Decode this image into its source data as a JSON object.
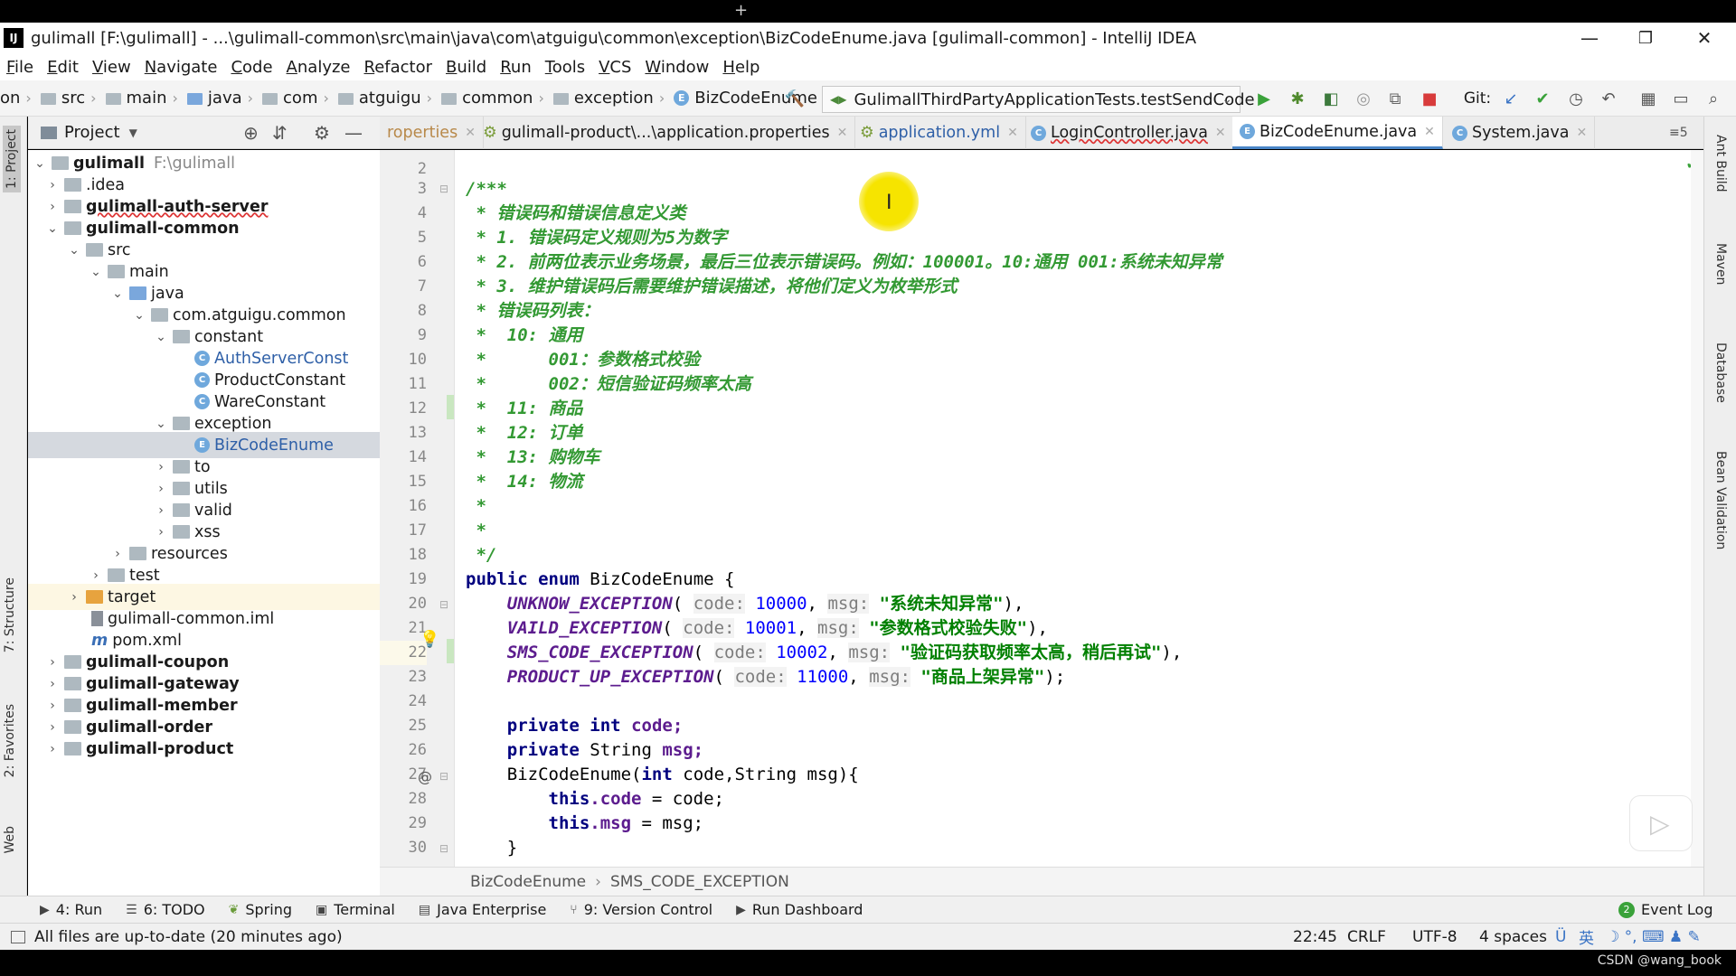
{
  "window": {
    "title": "gulimall [F:\\gulimall] - ...\\gulimall-common\\src\\main\\java\\com\\atguigu\\common\\exception\\BizCodeEnume.java [gulimall-common] - IntelliJ IDEA",
    "logo": "IJ",
    "minimize": "—",
    "restore": "❐",
    "close": "✕"
  },
  "menu": [
    "File",
    "Edit",
    "View",
    "Navigate",
    "Code",
    "Analyze",
    "Refactor",
    "Build",
    "Run",
    "Tools",
    "VCS",
    "Window",
    "Help"
  ],
  "nav": {
    "first": "on",
    "crumbs": [
      "src",
      "main",
      "java",
      "com",
      "atguigu",
      "common",
      "exception"
    ],
    "file": "BizCodeEnume",
    "run_config": "GulimallThirdPartyApplicationTests.testSendCode",
    "git_label": "Git:"
  },
  "left_tabs": {
    "project": "1: Project",
    "structure": "7: Structure",
    "favorites": "2: Favorites",
    "web": "Web"
  },
  "right_tabs": {
    "ant": "Ant Build",
    "maven": "Maven",
    "database": "Database",
    "bean": "Bean Validation"
  },
  "project_panel": {
    "title": "Project",
    "tree": [
      {
        "label": "gulimall",
        "extra": "F:\\gulimall"
      },
      {
        "label": ".idea"
      },
      {
        "label": "gulimall-auth-server"
      },
      {
        "label": "gulimall-common"
      },
      {
        "label": "src"
      },
      {
        "label": "main"
      },
      {
        "label": "java"
      },
      {
        "label": "com.atguigu.common"
      },
      {
        "label": "constant"
      },
      {
        "label": "AuthServerConst"
      },
      {
        "label": "ProductConstant"
      },
      {
        "label": "WareConstant"
      },
      {
        "label": "exception"
      },
      {
        "label": "BizCodeEnume"
      },
      {
        "label": "to"
      },
      {
        "label": "utils"
      },
      {
        "label": "valid"
      },
      {
        "label": "xss"
      },
      {
        "label": "resources"
      },
      {
        "label": "test"
      },
      {
        "label": "target"
      },
      {
        "label": "gulimall-common.iml"
      },
      {
        "label": "pom.xml"
      },
      {
        "label": "gulimall-coupon"
      },
      {
        "label": "gulimall-gateway"
      },
      {
        "label": "gulimall-member"
      },
      {
        "label": "gulimall-order"
      },
      {
        "label": "gulimall-product"
      }
    ]
  },
  "tabs": [
    {
      "label": "roperties"
    },
    {
      "label": "gulimall-product\\...\\application.properties"
    },
    {
      "label": "application.yml"
    },
    {
      "label": "LoginController.java"
    },
    {
      "label": "BizCodeEnume.java"
    },
    {
      "label": "System.java"
    }
  ],
  "tab_overflow": "≡5",
  "code": {
    "line_numbers": [
      "2",
      "3",
      "4",
      "5",
      "6",
      "7",
      "8",
      "9",
      "10",
      "11",
      "12",
      "13",
      "14",
      "15",
      "16",
      "17",
      "18",
      "19",
      "20",
      "21",
      "22",
      "23",
      "24",
      "25",
      "26",
      "27",
      "28",
      "29",
      "30"
    ],
    "c3": "/***",
    "c4": " * 错误码和错误信息定义类",
    "c5": " * 1. 错误码定义规则为5为数字",
    "c6": " * 2. 前两位表示业务场景，最后三位表示错误码。例如：100001。10:通用 001:系统未知异常",
    "c7": " * 3. 维护错误码后需要维护错误描述，将他们定义为枚举形式",
    "c8": " * 错误码列表：",
    "c9": " *  10: 通用",
    "c10": " *      001：参数格式校验",
    "c11": " *      002：短信验证码频率太高",
    "c12": " *  11: 商品",
    "c13": " *  12: 订单",
    "c14": " *  13: 购物车",
    "c15": " *  14: 物流",
    "c16": " *",
    "c17": " *",
    "c18": " */",
    "public": "public",
    "enum": "enum",
    "enum_name": " BizCodeEnume {",
    "code_hint": "code:",
    "msg_hint": "msg:",
    "e1": {
      "name": "UNKNOW_EXCEPTION",
      "code": "10000",
      "msg": "\"系统未知异常\"",
      "end": "),"
    },
    "e2": {
      "name": "VAILD_EXCEPTION",
      "code": "10001",
      "msg": "\"参数格式校验失败\"",
      "end": "),"
    },
    "e3": {
      "name": "SMS_CODE_EXCEPTION",
      "code": "10002",
      "msg": "\"验证码获取频率太高，稍后再试\"",
      "end": "),"
    },
    "e4": {
      "name": "PRODUCT_UP_EXCEPTION",
      "code": "11000",
      "msg": "\"商品上架异常\"",
      "end": ");"
    },
    "private": "private",
    "int": "int",
    "code_field": " code;",
    "string_type": " String ",
    "msg_field": "msg;",
    "ctor_name": "BizCodeEnume(",
    "ctor_params": " code,String msg){",
    "this": "this",
    "assign_code": ".code",
    "assign_code_rhs": " = code;",
    "assign_msg": ".msg",
    "assign_msg_rhs": " = msg;",
    "close_brace": "}",
    "annotation_marker": "@"
  },
  "editor_breadcrumb": [
    "BizCodeEnume",
    "SMS_CODE_EXCEPTION"
  ],
  "tool_windows": [
    {
      "label": "4: Run"
    },
    {
      "label": "6: TODO"
    },
    {
      "label": "Spring"
    },
    {
      "label": "Terminal"
    },
    {
      "label": "Java Enterprise"
    },
    {
      "label": "9: Version Control"
    },
    {
      "label": "Run Dashboard"
    }
  ],
  "event_log": "Event Log",
  "event_log_count": "2",
  "status": {
    "message": "All files are up-to-date (20 minutes ago)",
    "position": "22:45",
    "line_sep": "CRLF",
    "encoding": "UTF-8",
    "indent": "4 spaces",
    "ime": "英",
    "watermark": "CSDN @wang_book"
  },
  "colors": {
    "keyword": "#00007f",
    "comment": "#339933",
    "string": "#008000",
    "number": "#0000ff",
    "enum_const": "#5c1c8e",
    "selection": "#d5d9df"
  }
}
